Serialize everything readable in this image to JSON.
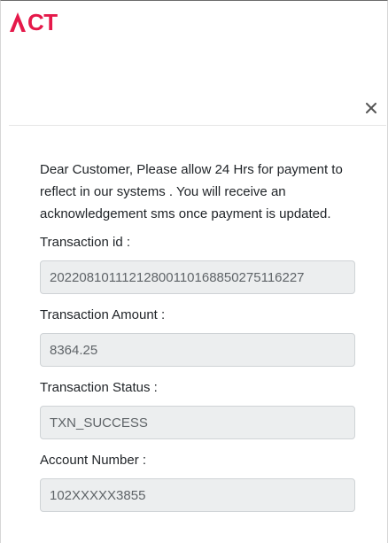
{
  "brand": {
    "logo_text": "CT",
    "logo_color": "#e5194a"
  },
  "dialog": {
    "close_label": "×",
    "message": "Dear Customer, Please allow 24 Hrs for payment to reflect in our systems . You will receive an acknowledgement sms once payment is updated.",
    "fields": [
      {
        "label": "Transaction id :",
        "value": "20220810111212800110168850275116227"
      },
      {
        "label": "Transaction Amount :",
        "value": "8364.25"
      },
      {
        "label": "Transaction Status :",
        "value": "TXN_SUCCESS"
      },
      {
        "label": "Account Number :",
        "value": "102XXXXX3855"
      }
    ]
  }
}
